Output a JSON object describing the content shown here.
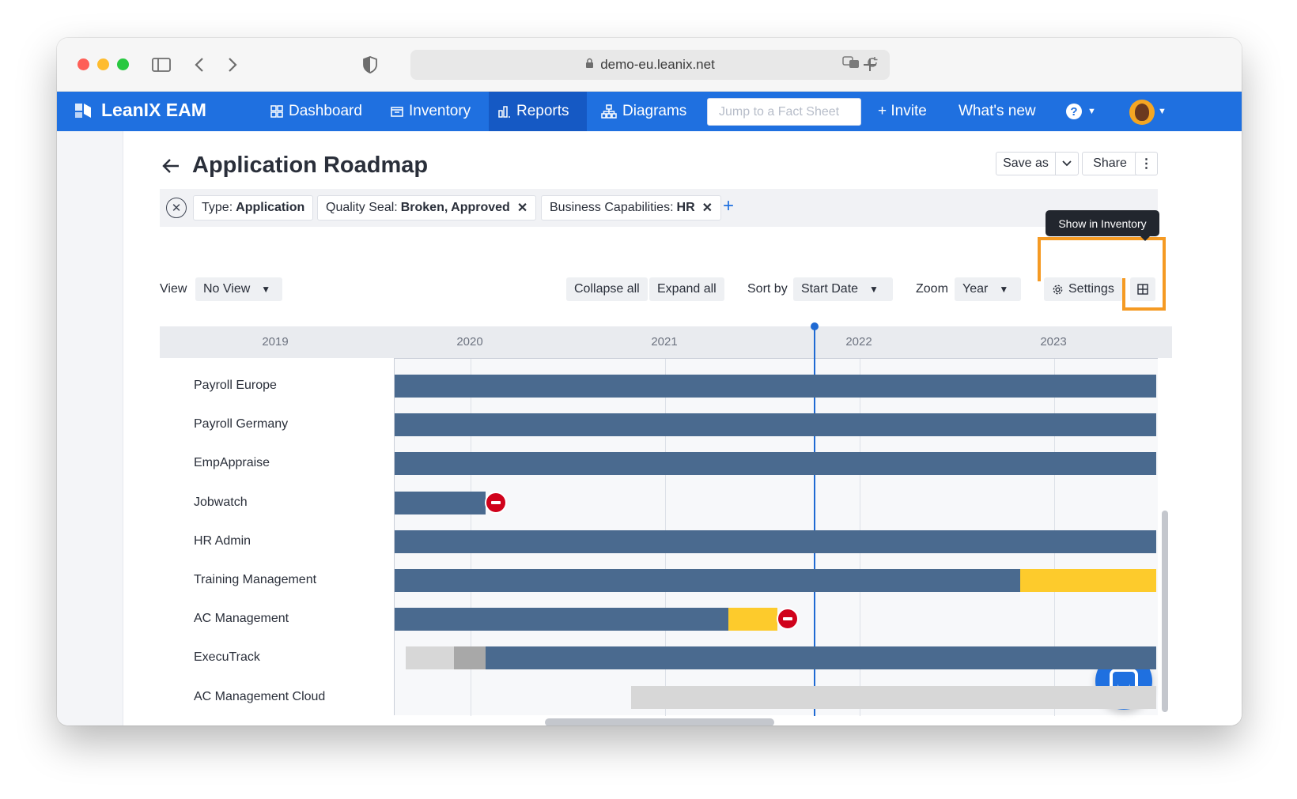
{
  "browser": {
    "url": "demo-eu.leanix.net"
  },
  "app": {
    "brand": "LeanIX EAM",
    "nav": [
      {
        "label": "Dashboard",
        "icon": "grid-icon"
      },
      {
        "label": "Inventory",
        "icon": "inventory-icon"
      },
      {
        "label": "Reports",
        "icon": "bar-chart-icon",
        "active": true
      },
      {
        "label": "Diagrams",
        "icon": "sitemap-icon"
      }
    ],
    "jump_placeholder": "Jump to a Fact Sheet",
    "invite": "+ Invite",
    "whats_new": "What's new",
    "help": "?"
  },
  "page": {
    "title": "Application Roadmap",
    "save_as": "Save as",
    "share": "Share",
    "filters": [
      {
        "key": "Type:",
        "value": "Application",
        "removable": false
      },
      {
        "key": "Quality Seal:",
        "value": "Broken, Approved",
        "removable": true
      },
      {
        "key": "Business Capabilities:",
        "value": "HR",
        "removable": true
      }
    ],
    "add_filter": "+",
    "tooltip": "Show in Inventory"
  },
  "toolbar": {
    "view_label": "View",
    "view_value": "No View",
    "collapse_all": "Collapse all",
    "expand_all": "Expand all",
    "sort_label": "Sort by",
    "sort_value": "Start Date",
    "zoom_label": "Zoom",
    "zoom_value": "Year",
    "settings": "Settings"
  },
  "colors": {
    "brand": "#1f70e0",
    "active_phase": "#4a6a8f",
    "phase_out": "#fdcb2c",
    "plan": "#d7d7d7",
    "phase_in": "#a8a8a8",
    "end_of_life": "#d0021b",
    "highlight": "#f59a23"
  },
  "timeline": {
    "years": [
      "2019",
      "2020",
      "2021",
      "2022",
      "2023"
    ],
    "today": 2021.76,
    "rows": [
      {
        "name": "Payroll Europe",
        "segments": [
          {
            "phase": "active",
            "start": 2019.6,
            "end": 2023.53
          }
        ]
      },
      {
        "name": "Payroll Germany",
        "segments": [
          {
            "phase": "active",
            "start": 2019.6,
            "end": 2023.53
          }
        ]
      },
      {
        "name": "EmpAppraise",
        "segments": [
          {
            "phase": "active",
            "start": 2019.6,
            "end": 2023.53
          }
        ]
      },
      {
        "name": "Jobwatch",
        "segments": [
          {
            "phase": "active",
            "start": 2019.6,
            "end": 2020.08
          }
        ],
        "end_of_life": 2020.08
      },
      {
        "name": "HR Admin",
        "segments": [
          {
            "phase": "active",
            "start": 2019.6,
            "end": 2023.53
          }
        ]
      },
      {
        "name": "Training Management",
        "segments": [
          {
            "phase": "active",
            "start": 2019.6,
            "end": 2022.83
          },
          {
            "phase": "phase_out",
            "start": 2022.83,
            "end": 2023.53
          }
        ]
      },
      {
        "name": "AC Management",
        "segments": [
          {
            "phase": "active",
            "start": 2019.6,
            "end": 2021.33
          },
          {
            "phase": "phase_out",
            "start": 2021.33,
            "end": 2021.58
          }
        ],
        "end_of_life": 2021.58
      },
      {
        "name": "ExecuTrack",
        "segments": [
          {
            "phase": "plan",
            "start": 2019.67,
            "end": 2019.92
          },
          {
            "phase": "phase_in",
            "start": 2019.92,
            "end": 2020.08
          },
          {
            "phase": "active",
            "start": 2020.08,
            "end": 2023.53
          }
        ]
      },
      {
        "name": "AC Management Cloud",
        "segments": [
          {
            "phase": "plan",
            "start": 2020.83,
            "end": 2023.53
          }
        ]
      }
    ]
  }
}
